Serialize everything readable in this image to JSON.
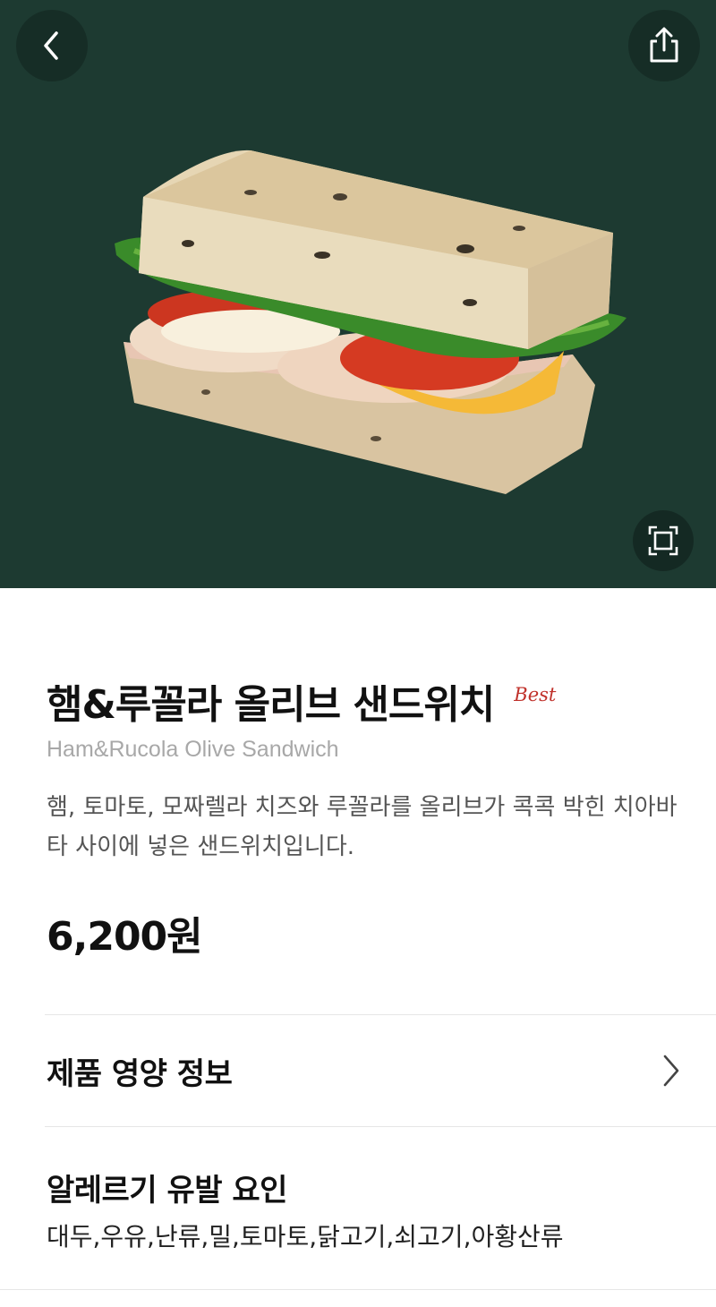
{
  "header": {
    "back_icon": "chevron-left-icon",
    "share_icon": "share-icon",
    "zoom_icon": "expand-icon",
    "hero_color": "#1d3a31"
  },
  "product": {
    "name": "햄&루꼴라 올리브 샌드위치",
    "badge": "Best",
    "name_en": "Ham&Rucola Olive Sandwich",
    "description": "햄, 토마토, 모짜렐라 치즈와 루꼴라를 올리브가 콕콕 박힌 치아바타 사이에 넣은 샌드위치입니다.",
    "price": "6,200원"
  },
  "nutrition": {
    "label": "제품 영양 정보",
    "icon": "chevron-right-icon"
  },
  "allergy": {
    "title": "알레르기 유발 요인",
    "list": "대두,우유,난류,밀,토마토,닭고기,쇠고기,아황산류"
  }
}
